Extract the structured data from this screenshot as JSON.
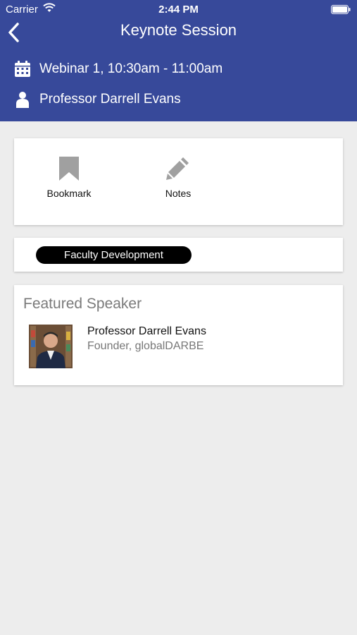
{
  "status_bar": {
    "carrier": "Carrier",
    "time": "2:44 PM"
  },
  "nav": {
    "title": "Keynote Session",
    "back_icon": "chevron-left-icon"
  },
  "session": {
    "time": "Webinar 1, 10:30am - 11:00am",
    "speaker": "Professor Darrell Evans",
    "time_icon": "calendar-icon",
    "speaker_icon": "person-icon"
  },
  "actions": {
    "bookmark_label": "Bookmark",
    "notes_label": "Notes",
    "bookmark_icon": "bookmark-icon",
    "notes_icon": "pencil-icon"
  },
  "tags": [
    "Faculty Development"
  ],
  "featured": {
    "title": "Featured Speaker",
    "speaker_name": "Professor Darrell Evans",
    "speaker_role": "Founder, globalDARBE"
  },
  "colors": {
    "header": "#37499a",
    "background": "#ededed",
    "tag": "#000000",
    "icon_gray": "#a0a0a0"
  }
}
